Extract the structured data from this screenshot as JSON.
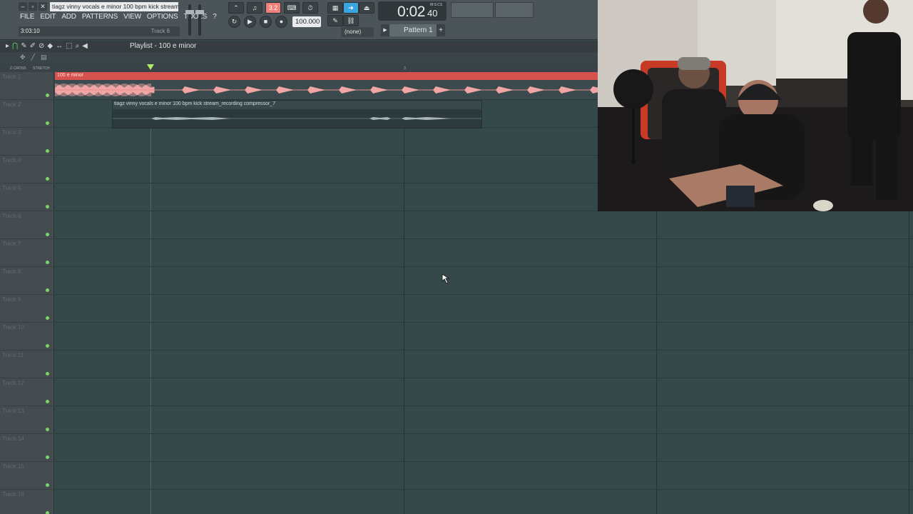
{
  "window": {
    "project_title": "tiagz vinny vocals e minor 100 bpm kick stream.",
    "controls": [
      "–",
      "▫",
      "✕"
    ]
  },
  "menu": [
    "FILE",
    "EDIT",
    "ADD",
    "PATTERNS",
    "VIEW",
    "OPTIONS",
    "TOOLS",
    "?"
  ],
  "hint_bar": {
    "time": "3:03:10",
    "track": "Track 8"
  },
  "transport": {
    "tempo": "100.000",
    "time_main": "0:02",
    "time_cs": "40",
    "time_label": "M:S:CS",
    "snap": "(none)",
    "pattern": "Pattern 1",
    "mode_badge": "3.2"
  },
  "playlist": {
    "title": "Playlist - 100 e minor",
    "xfade_label": "Z-CROSS",
    "stretch_label": "STRETCH",
    "bar_label": "3",
    "tracks": [
      "Track 1",
      "Track 2",
      "Track 3",
      "Track 4",
      "Track 5",
      "Track 6",
      "Track 7",
      "Track 8",
      "Track 9",
      "Track 10",
      "Track 11",
      "Track 12",
      "Track 13",
      "Track 14",
      "Track 15",
      "Track 16"
    ],
    "clips": [
      {
        "name": "100 e minor",
        "color": "#d5524f"
      },
      {
        "name": "tiagz vinny vocals e minor 100 bpm kick stream_recording compressor_7",
        "color": "#39484b"
      }
    ]
  },
  "colors": {
    "accent_red": "#f37f7a",
    "accent_blue": "#39a6e0",
    "grid_bg": "#35494a",
    "led_green": "#7fd36a"
  }
}
